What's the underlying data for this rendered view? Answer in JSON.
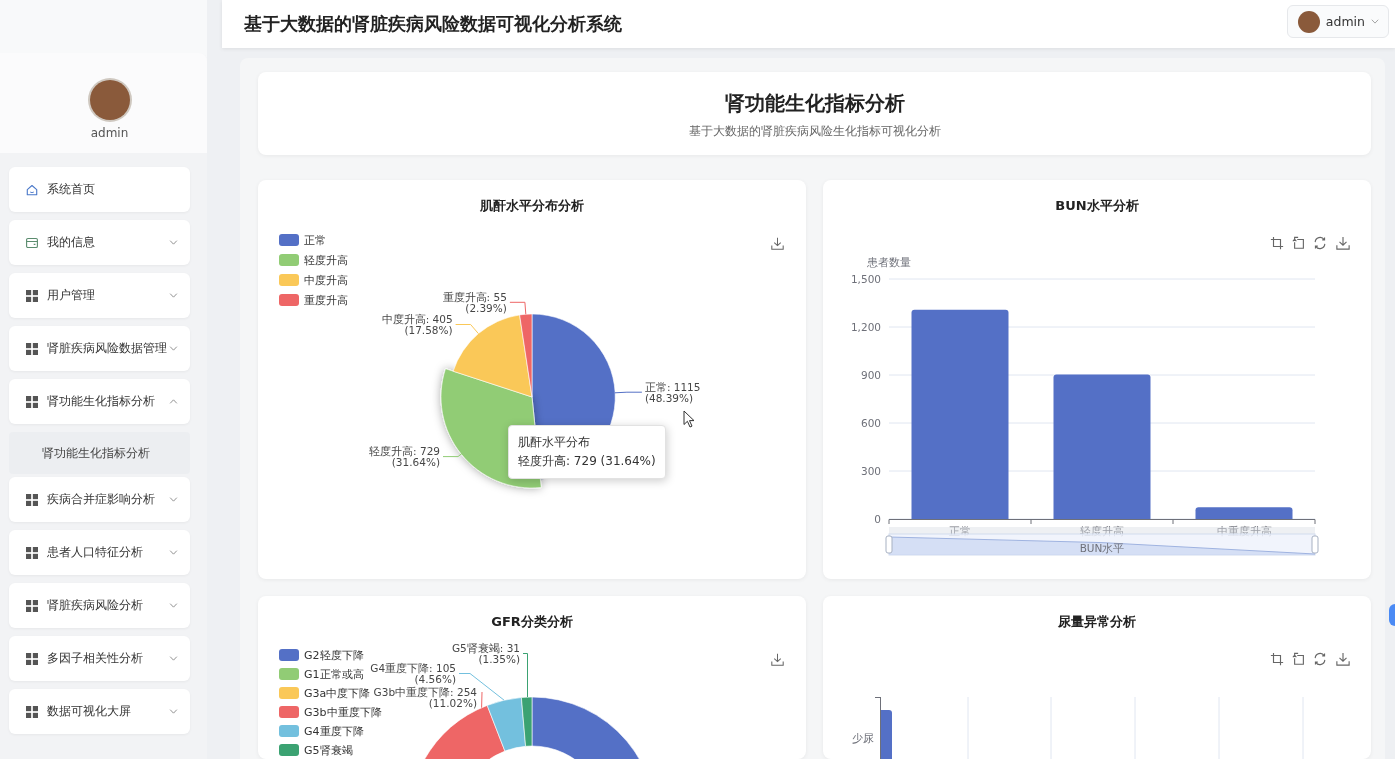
{
  "header": {
    "title": "基于大数据的肾脏疾病风险数据可视化分析系统",
    "user": "admin"
  },
  "sidebar": {
    "user": "admin",
    "items": [
      {
        "label": "系统首页",
        "kind": "home"
      },
      {
        "label": "我的信息",
        "kind": "profile",
        "expanded": false
      },
      {
        "label": "用户管理",
        "kind": "module",
        "expanded": false
      },
      {
        "label": "肾脏疾病风险数据管理",
        "kind": "module",
        "expanded": false
      },
      {
        "label": "肾功能生化指标分析",
        "kind": "module",
        "expanded": true,
        "children": [
          {
            "label": "肾功能生化指标分析",
            "selected": true
          }
        ]
      },
      {
        "label": "疾病合并症影响分析",
        "kind": "module",
        "expanded": false
      },
      {
        "label": "患者人口特征分析",
        "kind": "module",
        "expanded": false
      },
      {
        "label": "肾脏疾病风险分析",
        "kind": "module",
        "expanded": false
      },
      {
        "label": "多因子相关性分析",
        "kind": "module",
        "expanded": false
      },
      {
        "label": "数据可视化大屏",
        "kind": "module",
        "expanded": false
      }
    ]
  },
  "page_header": {
    "title": "肾功能生化指标分析",
    "subtitle": "基于大数据的肾脏疾病风险生化指标可视化分析"
  },
  "panels": [
    {
      "title": "肌酐水平分布分析",
      "chart_data": {
        "type": "pie",
        "categories": [
          "正常",
          "轻度升高",
          "中度升高",
          "重度升高"
        ],
        "values": [
          48.39,
          31.64,
          17.58,
          2.39
        ],
        "colors": [
          "#5470c6",
          "#91cc75",
          "#fac858",
          "#ee6666"
        ],
        "legend": true,
        "data_labels": true,
        "value_labels": [
          [
            "正常: 1115",
            "(48.39%)"
          ],
          [
            "轻度升高: 729",
            "(31.64%)"
          ],
          [
            "中度升高: 405",
            "(17.58%)"
          ],
          [
            "重度升高: 55",
            "(2.39%)"
          ]
        ]
      },
      "highlighted": [
        false,
        true,
        false,
        false
      ],
      "tooltip": {
        "title": "肌酐水平分布",
        "text": "轻度升高: 729 (31.64%)"
      }
    },
    {
      "title": "BUN水平分析",
      "chart_data": {
        "type": "bar",
        "xlabel": "BUN水平",
        "ylabel": "患者数量",
        "categories": [
          "正常",
          "轻度升高",
          "中重度升高"
        ],
        "values": [
          1308,
          904,
          73
        ],
        "ylim": [
          0,
          1500
        ],
        "yticks": [
          0,
          300,
          600,
          900,
          {
            "value": 1200,
            "label": "1,200"
          },
          {
            "value": 1500,
            "label": "1,500"
          }
        ],
        "grid": true
      }
    },
    {
      "kind": "donut",
      "title": "GFR分类分析",
      "legend": [
        {
          "label": "G2轻度下降",
          "color": "#5470c6"
        },
        {
          "label": "G1正常或高",
          "color": "#91cc75"
        },
        {
          "label": "G3a中度下降",
          "color": "#fac858"
        },
        {
          "label": "G3b中重度下降",
          "color": "#ee6666",
          "slice_label": [
            "G3b中重度下降: 254",
            "(11.02%)"
          ]
        },
        {
          "label": "G4重度下降",
          "color": "#73c0de",
          "slice_label": [
            "G4重度下降: 105",
            "(4.56%)"
          ]
        },
        {
          "label": "G5肾衰竭",
          "color": "#3ba272",
          "slice_label": [
            "G5肾衰竭: 31",
            "(1.35%)"
          ]
        }
      ]
    },
    {
      "kind": "hbar",
      "title": "尿量异常分析",
      "axis_labels": [
        "少尿"
      ]
    }
  ]
}
